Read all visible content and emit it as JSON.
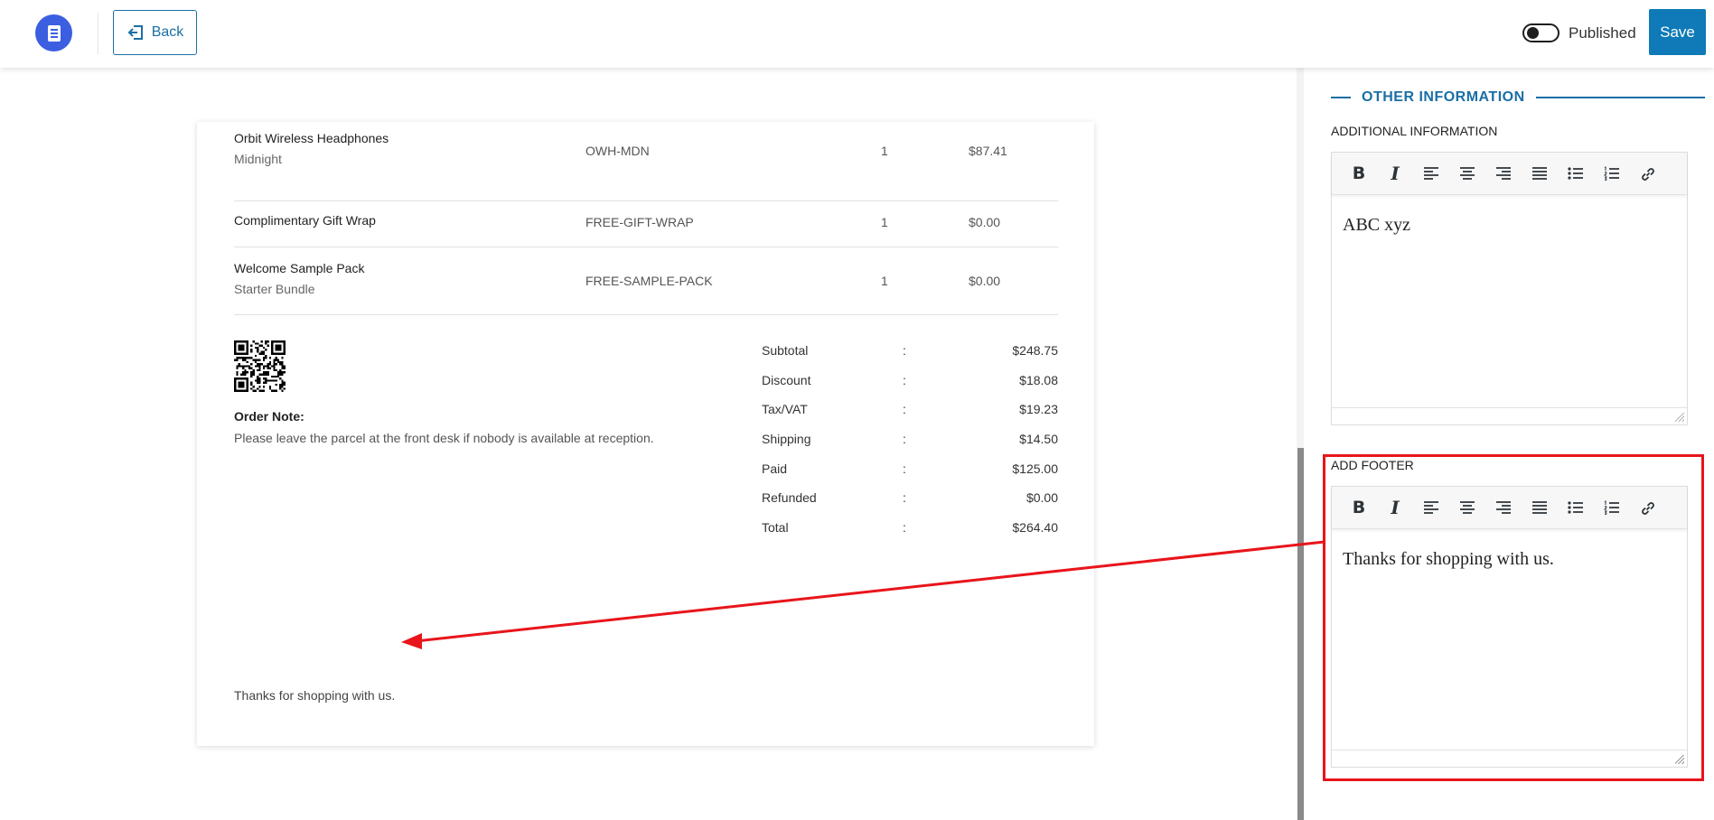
{
  "topbar": {
    "logo_icon": "receipt-icon",
    "back_label": "Back",
    "published_label": "Published",
    "published_on": false,
    "save_label": "Save",
    "accent_color": "#0f7ab7"
  },
  "invoice": {
    "items": [
      {
        "name": "Orbit Wireless Headphones",
        "variant": "Midnight",
        "sku": "OWH-MDN",
        "qty": "1",
        "price": "$87.41"
      },
      {
        "name": "Complimentary Gift Wrap",
        "variant": "",
        "sku": "FREE-GIFT-WRAP",
        "qty": "1",
        "price": "$0.00"
      },
      {
        "name": "Welcome Sample Pack",
        "variant": "Starter Bundle",
        "sku": "FREE-SAMPLE-PACK",
        "qty": "1",
        "price": "$0.00"
      }
    ],
    "order_note_title": "Order Note:",
    "order_note_text": "Please leave the parcel at the front desk if nobody is available at reception.",
    "totals": [
      {
        "label": "Subtotal",
        "colon": ":",
        "value": "$248.75"
      },
      {
        "label": "Discount",
        "colon": ":",
        "value": "$18.08"
      },
      {
        "label": "Tax/VAT",
        "colon": ":",
        "value": "$19.23"
      },
      {
        "label": "Shipping",
        "colon": ":",
        "value": "$14.50"
      },
      {
        "label": "Paid",
        "colon": ":",
        "value": "$125.00"
      },
      {
        "label": "Refunded",
        "colon": ":",
        "value": "$0.00"
      },
      {
        "label": "Total",
        "colon": ":",
        "value": "$264.40"
      }
    ],
    "footer_text": "Thanks for shopping with us."
  },
  "sidebar": {
    "section_title": "OTHER INFORMATION",
    "additional_info_label": "ADDITIONAL INFORMATION",
    "additional_info_value": "ABC xyz",
    "add_footer_label": "ADD FOOTER",
    "add_footer_value": "Thanks for shopping with us.",
    "toolbar_icons": [
      "bold-icon",
      "italic-icon",
      "align-left-icon",
      "align-center-icon",
      "align-right-icon",
      "align-justify-icon",
      "bulleted-list-icon",
      "numbered-list-icon",
      "link-icon"
    ]
  },
  "annotation": {
    "highlight_color": "#e8151b"
  }
}
